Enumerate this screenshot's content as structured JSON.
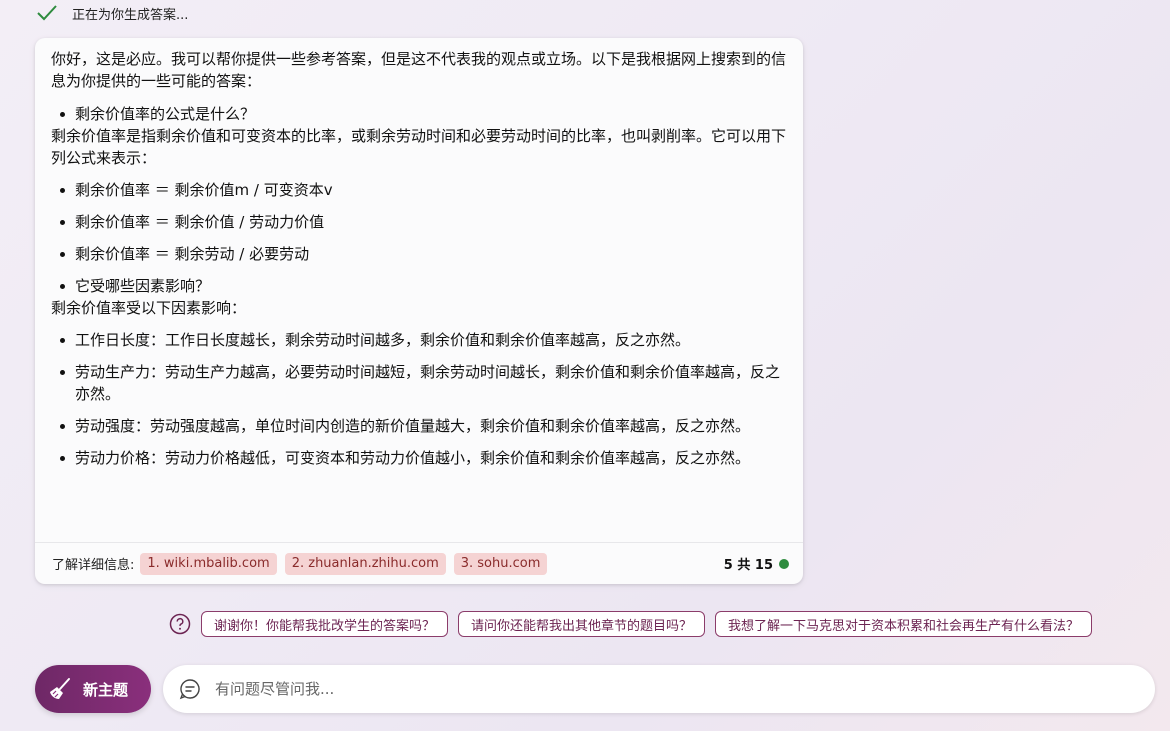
{
  "status": {
    "text": "正在为你生成答案..."
  },
  "answer": {
    "intro": "你好，这是必应。我可以帮你提供一些参考答案，但是这不代表我的观点或立场。以下是我根据网上搜索到的信息为你提供的一些可能的答案：",
    "q1": "剩余价值率的公式是什么？",
    "p1": "剩余价值率是指剩余价值和可变资本的比率，或剩余劳动时间和必要劳动时间的比率，也叫剥削率。它可以用下列公式来表示：",
    "formulas": [
      "剩余价值率 ＝ 剩余价值m / 可变资本v",
      "剩余价值率 ＝ 剩余价值 / 劳动力价值",
      "剩余价值率 ＝ 剩余劳动 / 必要劳动"
    ],
    "q2": "它受哪些因素影响？",
    "p2": "剩余价值率受以下因素影响：",
    "factors": [
      "工作日长度：工作日长度越长，剩余劳动时间越多，剩余价值和剩余价值率越高，反之亦然。",
      "劳动生产力：劳动生产力越高，必要劳动时间越短，剩余劳动时间越长，剩余价值和剩余价值率越高，反之亦然。",
      "劳动强度：劳动强度越高，单位时间内创造的新价值量越大，剩余价值和剩余价值率越高，反之亦然。",
      "劳动力价格：劳动力价格越低，可变资本和劳动力价值越小，剩余价值和剩余价值率越高，反之亦然。"
    ]
  },
  "footer": {
    "label": "了解详细信息:",
    "citations": [
      "1. wiki.mbalib.com",
      "2. zhuanlan.zhihu.com",
      "3. sohu.com"
    ],
    "count": "5 共 15",
    "status_color": "#2e8b3e"
  },
  "suggestions": [
    "谢谢你！你能帮我批改学生的答案吗？",
    "请问你还能帮我出其他章节的题目吗？",
    "我想了解一下马克思对于资本积累和社会再生产有什么看法？"
  ],
  "new_topic": {
    "label": "新主题",
    "icon": "broom-icon"
  },
  "input": {
    "placeholder": "有问题尽管问我...",
    "icon": "chat-icon"
  }
}
